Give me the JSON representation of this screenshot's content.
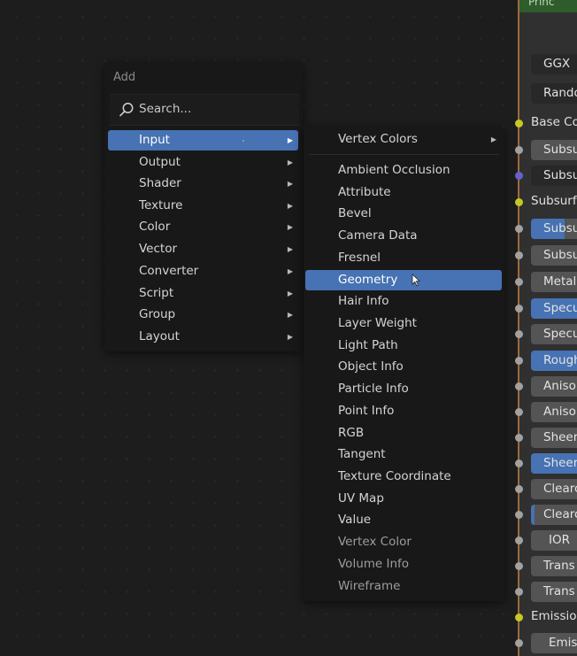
{
  "add_menu": {
    "title": "Add",
    "search_placeholder": "Search...",
    "items": [
      "Input",
      "Output",
      "Shader",
      "Texture",
      "Color",
      "Vector",
      "Converter",
      "Script",
      "Group",
      "Layout"
    ]
  },
  "input_submenu": {
    "top_item": "Vertex Colors",
    "items": [
      "Ambient Occlusion",
      "Attribute",
      "Bevel",
      "Camera Data",
      "Fresnel",
      "Geometry",
      "Hair Info",
      "Layer Weight",
      "Light Path",
      "Object Info",
      "Particle Info",
      "Point Info",
      "RGB",
      "Tangent",
      "Texture Coordinate",
      "UV Map",
      "Value",
      "Vertex Color",
      "Volume Info",
      "Wireframe"
    ]
  },
  "node": {
    "header": "Princ",
    "dropdowns": [
      "GGX",
      "Rando"
    ],
    "inputs": [
      "Base Co",
      "Subsu",
      "Subsu",
      "Subsurf",
      "Subsu",
      "Subsu",
      "Metal",
      "Specu",
      "Specu",
      "Rough",
      "Aniso",
      "Aniso",
      "Sheer",
      "Sheer",
      "Clearc",
      "Clearc",
      "IOR",
      "Trans",
      "Trans",
      "Emissio",
      "Emis"
    ]
  },
  "colors": {
    "accent": "#4772b3",
    "menu_bg": "#181818",
    "canvas_bg": "#1d1d1d"
  }
}
